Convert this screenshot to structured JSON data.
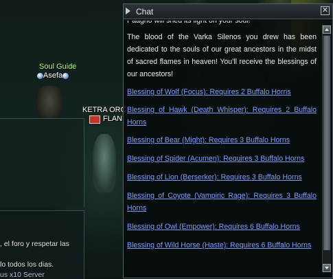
{
  "world": {
    "npc": {
      "title": "Soul Guide",
      "name": "Asefa"
    },
    "player": {
      "clan": "KETRA ORC",
      "name": "FLAN"
    },
    "system_messages": [
      ", el foro y respetar las",
      "lo todos los dias.",
      "us x10 Server"
    ]
  },
  "chat": {
    "title": "Chat",
    "close_glyph": "✕",
    "truncated_line": "Paagrio will shed its light on your soul!",
    "paragraph": "The blood of the Varka Silenos you drew has been dedicated to the souls of our great ancestors in the midst of sacred flames in heaven! You'll receive the blessings of our ancestors!",
    "links": [
      "Blessing of Wolf (Focus): Requires 2 Buffalo Horns",
      "Blessing of Hawk (Death Whisper): Requires 2 Buffalo Horns",
      "Blessing of Bear (Might): Requires 3 Buffalo Horns",
      "Blessing of Spider (Acumen): Requires 3 Buffalo Horns",
      "Blessing of Lion (Berserker): Requires 3 Buffalo Horns",
      "Blessing of Coyote (Vampiric Rage): Requires 3 Buffalo Horns",
      "Blessing of Owl (Empower): Requires 6 Buffalo Horns",
      "Blessing of Wild Horse (Haste): Requires 6 Buffalo Horns"
    ]
  },
  "icons": {
    "caret": "caret-right-icon",
    "close": "close-icon",
    "scroll_up": "arrow-up-icon",
    "scroll_down": "arrow-down-icon"
  }
}
